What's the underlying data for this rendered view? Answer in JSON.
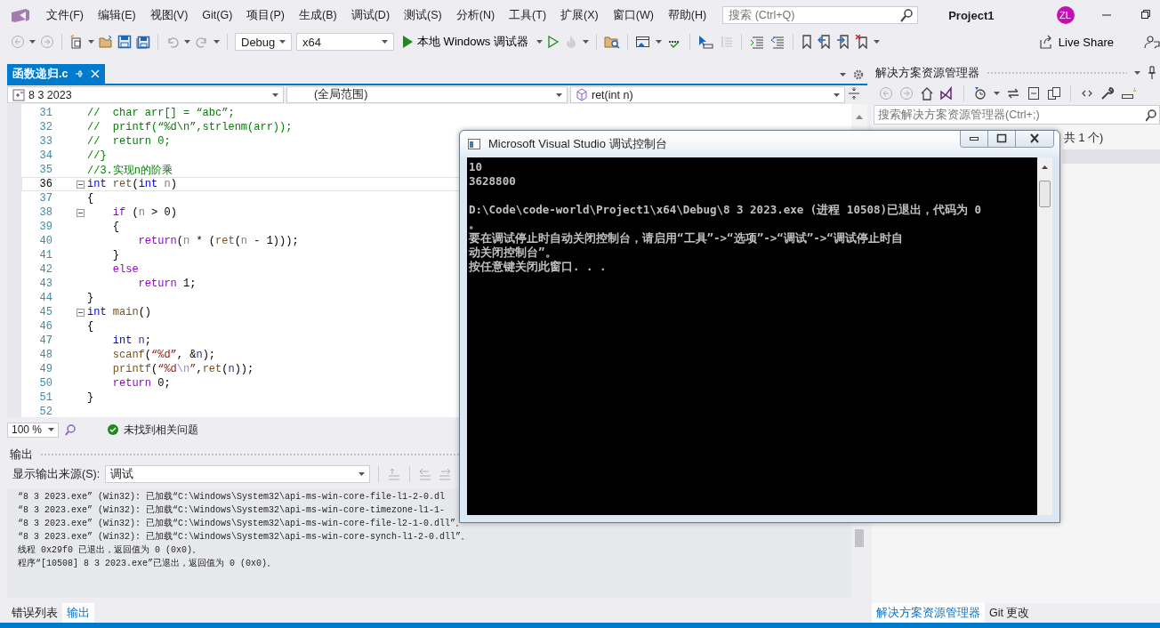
{
  "menu": {
    "items": [
      "文件(F)",
      "编辑(E)",
      "视图(V)",
      "Git(G)",
      "项目(P)",
      "生成(B)",
      "调试(D)",
      "测试(S)",
      "分析(N)",
      "工具(T)",
      "扩展(X)",
      "窗口(W)",
      "帮助(H)"
    ],
    "search": {
      "placeholder": "搜索 (Ctrl+Q)"
    },
    "project": "Project1",
    "avatar": "ZL"
  },
  "toolbar": {
    "configuration": "Debug",
    "platform": "x64",
    "run": "本地 Windows 调试器",
    "live_share": "Live Share"
  },
  "editor": {
    "tabs": [
      {
        "label": "函数递归.c",
        "selected": true
      }
    ],
    "nav": [
      "8 3 2023",
      "(全局范围)",
      "ret(int n)"
    ],
    "lines": [
      {
        "num": "31",
        "fold": false,
        "current": false,
        "tokens": [
          {
            "kind": "comment",
            "text": "//  char arr[] = “abc”;"
          }
        ]
      },
      {
        "num": "32",
        "fold": false,
        "current": false,
        "tokens": [
          {
            "kind": "comment",
            "text": "//  printf(“%d\\n”,strlenm(arr));"
          }
        ]
      },
      {
        "num": "33",
        "fold": false,
        "current": false,
        "tokens": [
          {
            "kind": "comment",
            "text": "//  return 0;"
          }
        ]
      },
      {
        "num": "34",
        "fold": false,
        "current": false,
        "tokens": [
          {
            "kind": "comment",
            "text": "//}"
          }
        ]
      },
      {
        "num": "35",
        "fold": false,
        "current": false,
        "tokens": [
          {
            "kind": "comment",
            "text": "//3.实现n的阶乘"
          }
        ]
      },
      {
        "num": "36",
        "fold": true,
        "current": true,
        "tokens": [
          {
            "kind": "type",
            "text": "int"
          },
          {
            "kind": "func",
            "text": " ret"
          },
          {
            "kind": "plain",
            "text": "("
          },
          {
            "kind": "type",
            "text": "int"
          },
          {
            "kind": "param",
            "text": " n"
          },
          {
            "kind": "plain",
            "text": ")"
          }
        ]
      },
      {
        "num": "37",
        "fold": false,
        "current": false,
        "tokens": [
          {
            "kind": "plain",
            "text": "{"
          }
        ]
      },
      {
        "num": "38",
        "fold": true,
        "current": false,
        "tokens": [
          {
            "kind": "control",
            "text": "    if"
          },
          {
            "kind": "plain",
            "text": " ("
          },
          {
            "kind": "param",
            "text": "n"
          },
          {
            "kind": "plain",
            "text": " > 0)"
          }
        ]
      },
      {
        "num": "39",
        "fold": false,
        "current": false,
        "tokens": [
          {
            "kind": "plain",
            "text": "    {"
          }
        ]
      },
      {
        "num": "40",
        "fold": false,
        "current": false,
        "tokens": [
          {
            "kind": "control",
            "text": "        return"
          },
          {
            "kind": "plain",
            "text": "("
          },
          {
            "kind": "param",
            "text": "n"
          },
          {
            "kind": "plain",
            "text": " * ("
          },
          {
            "kind": "func",
            "text": "ret"
          },
          {
            "kind": "plain",
            "text": "("
          },
          {
            "kind": "param",
            "text": "n"
          },
          {
            "kind": "plain",
            "text": " - 1)));"
          }
        ]
      },
      {
        "num": "41",
        "fold": false,
        "current": false,
        "tokens": [
          {
            "kind": "plain",
            "text": "    }"
          }
        ]
      },
      {
        "num": "42",
        "fold": false,
        "current": false,
        "tokens": [
          {
            "kind": "control",
            "text": "    else"
          }
        ]
      },
      {
        "num": "43",
        "fold": false,
        "current": false,
        "tokens": [
          {
            "kind": "control",
            "text": "        return"
          },
          {
            "kind": "plain",
            "text": " 1;"
          }
        ]
      },
      {
        "num": "44",
        "fold": false,
        "current": false,
        "tokens": [
          {
            "kind": "plain",
            "text": "}"
          }
        ]
      },
      {
        "num": "45",
        "fold": true,
        "current": false,
        "tokens": [
          {
            "kind": "type",
            "text": "int"
          },
          {
            "kind": "func",
            "text": " main"
          },
          {
            "kind": "plain",
            "text": "()"
          }
        ]
      },
      {
        "num": "46",
        "fold": false,
        "current": false,
        "tokens": [
          {
            "kind": "plain",
            "text": "{"
          }
        ]
      },
      {
        "num": "47",
        "fold": false,
        "current": false,
        "tokens": [
          {
            "kind": "type",
            "text": "    int"
          },
          {
            "kind": "local",
            "text": " n"
          },
          {
            "kind": "plain",
            "text": ";"
          }
        ]
      },
      {
        "num": "48",
        "fold": false,
        "current": false,
        "tokens": [
          {
            "kind": "func",
            "text": "    scanf"
          },
          {
            "kind": "plain",
            "text": "("
          },
          {
            "kind": "string",
            "text": "“%d”"
          },
          {
            "kind": "plain",
            "text": ", &"
          },
          {
            "kind": "local",
            "text": "n"
          },
          {
            "kind": "plain",
            "text": ");"
          }
        ]
      },
      {
        "num": "49",
        "fold": false,
        "current": false,
        "tokens": [
          {
            "kind": "func",
            "text": "    printf"
          },
          {
            "kind": "plain",
            "text": "("
          },
          {
            "kind": "string",
            "text": "“%d"
          },
          {
            "kind": "escape",
            "text": "\\n"
          },
          {
            "kind": "string",
            "text": "”"
          },
          {
            "kind": "plain",
            "text": ","
          },
          {
            "kind": "func",
            "text": "ret"
          },
          {
            "kind": "plain",
            "text": "("
          },
          {
            "kind": "local",
            "text": "n"
          },
          {
            "kind": "plain",
            "text": "));"
          }
        ]
      },
      {
        "num": "50",
        "fold": false,
        "current": false,
        "tokens": [
          {
            "kind": "control",
            "text": "    return"
          },
          {
            "kind": "plain",
            "text": " 0;"
          }
        ]
      },
      {
        "num": "51",
        "fold": false,
        "current": false,
        "tokens": [
          {
            "kind": "plain",
            "text": "}"
          }
        ]
      },
      {
        "num": "52",
        "fold": false,
        "current": false
      }
    ],
    "zoom": "100 %",
    "issues": "未找到相关问题"
  },
  "output": {
    "title": "输出",
    "source_label": "显示输出来源(S):",
    "source": "调试",
    "lines": [
      "“8 3 2023.exe” (Win32): 已加载“C:\\Windows\\System32\\api-ms-win-core-file-l1-2-0.dl",
      "“8 3 2023.exe” (Win32): 已加载“C:\\Windows\\System32\\api-ms-win-core-timezone-l1-1-",
      "“8 3 2023.exe” (Win32): 已加载“C:\\Windows\\System32\\api-ms-win-core-file-l2-1-0.dll”。",
      "“8 3 2023.exe” (Win32): 已加载“C:\\Windows\\System32\\api-ms-win-core-synch-l1-2-0.dll”。",
      "线程 0x29f0 已退出，返回值为 0 (0x0)。",
      "程序“[10508] 8 3 2023.exe”已退出，返回值为 0 (0x0)。"
    ],
    "tabs": [
      {
        "label": "错误列表",
        "selected": false
      },
      {
        "label": "输出",
        "selected": true
      }
    ]
  },
  "solution_explorer": {
    "title": "解决方案资源管理器",
    "search": {
      "placeholder": "搜索解决方案资源管理器(Ctrl+;)"
    },
    "tree_text": "共 1 个)",
    "tabs": [
      {
        "label": "解决方案资源管理器",
        "selected": true
      },
      {
        "label": "Git 更改",
        "selected": false
      }
    ]
  },
  "console": {
    "title": "Microsoft Visual Studio 调试控制台",
    "blocks": [
      [
        "10",
        "3628800"
      ],
      [
        "D:\\Code\\code-world\\Project1\\x64\\Debug\\8 3 2023.exe (进程 10508)已退出，代码为 0",
        "。",
        "要在调试停止时自动关闭控制台，请启用“工具”->“选项”->“调试”->“调试停止时自",
        "动关闭控制台”。",
        "按任意键关闭此窗口. . ."
      ]
    ]
  }
}
